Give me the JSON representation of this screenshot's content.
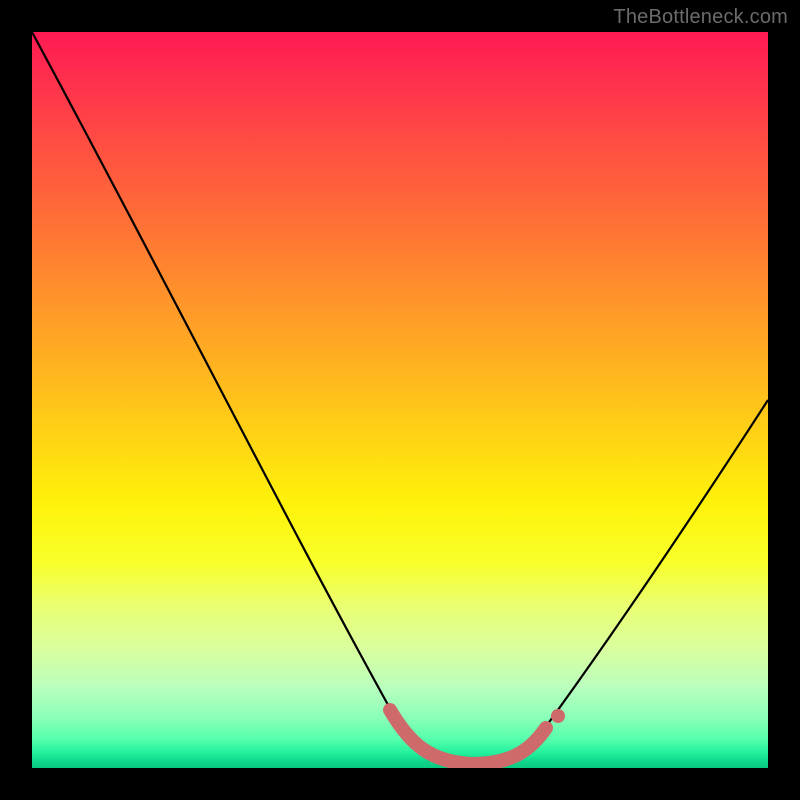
{
  "watermark": "TheBottleneck.com",
  "chart_data": {
    "type": "line",
    "title": "",
    "xlabel": "",
    "ylabel": "",
    "xlim": [
      0,
      100
    ],
    "ylim": [
      0,
      100
    ],
    "grid": false,
    "legend": false,
    "series": [
      {
        "name": "curve",
        "x": [
          0,
          5,
          10,
          15,
          20,
          25,
          30,
          35,
          40,
          45,
          50,
          53,
          57,
          60,
          63,
          66,
          70,
          75,
          80,
          85,
          90,
          95,
          100
        ],
        "values": [
          100,
          90,
          80,
          70,
          60,
          50,
          40,
          30,
          21,
          13,
          6,
          3,
          1,
          0.5,
          0.5,
          1,
          3,
          8,
          15,
          23,
          32,
          41,
          50
        ]
      },
      {
        "name": "highlight-band",
        "x": [
          50,
          53,
          57,
          60,
          63,
          66,
          70
        ],
        "values": [
          6,
          3,
          1,
          0.5,
          0.5,
          1,
          3
        ]
      }
    ],
    "colors": {
      "curve": "#000000",
      "highlight": "#cf6a6a",
      "gradient_top": "#ff1a52",
      "gradient_bottom": "#08c87f"
    }
  }
}
